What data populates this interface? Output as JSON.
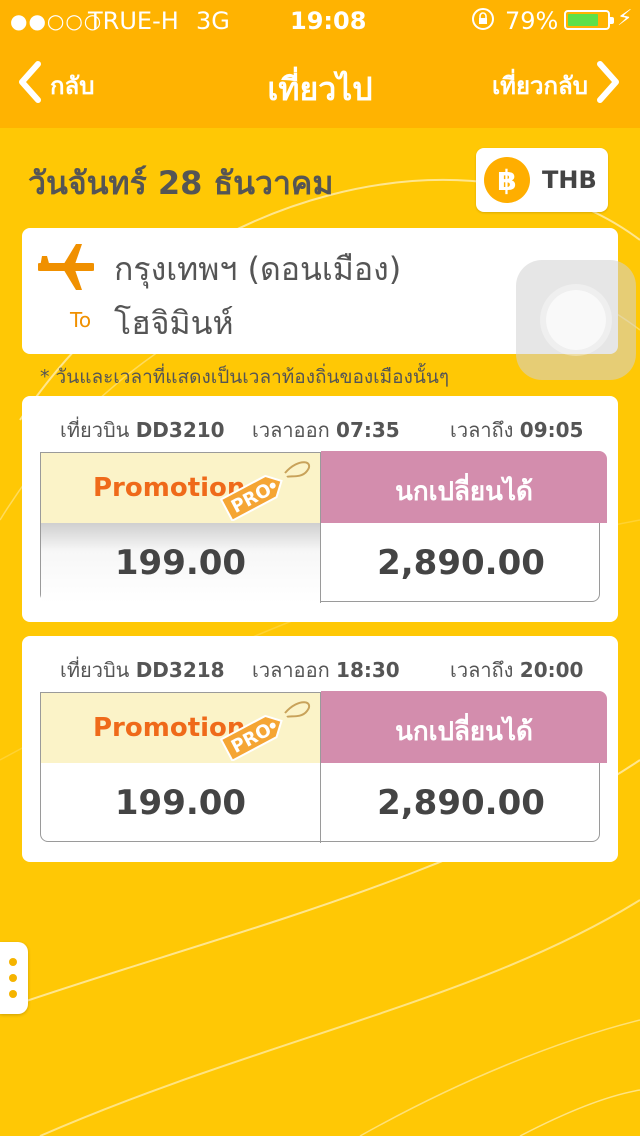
{
  "status_bar": {
    "signal": "●●○○○",
    "carrier": "TRUE-H",
    "network": "3G",
    "time": "19:08",
    "battery_percent": "79%",
    "battery_level": 0.79
  },
  "nav": {
    "back_label": "กลับ",
    "title": "เที่ยวไป",
    "forward_label": "เที่ยวกลับ"
  },
  "date": "วันจันทร์ 28 ธันวาคม",
  "currency": {
    "symbol": "฿",
    "code": "THB"
  },
  "route": {
    "from": "กรุงเทพฯ (ดอนเมือง)",
    "to_label": "To",
    "to": "โฮจิมินห์"
  },
  "note": "* วันและเวลาที่แสดงเป็นเวลาท้องถิ่นของเมืองนั้นๆ",
  "flights": [
    {
      "flight_label": "เที่ยวบิน",
      "flight_no": "DD3210",
      "depart_label": "เวลาออก",
      "depart_time": "07:35",
      "arrive_label": "เวลาถึง",
      "arrive_time": "09:05",
      "promo_label": "Promotion",
      "promo_tag": "PRO",
      "promo_price": "199.00",
      "flex_label": "นกเปลี่ยนได้",
      "flex_price": "2,890.00"
    },
    {
      "flight_label": "เที่ยวบิน",
      "flight_no": "DD3218",
      "depart_label": "เวลาออก",
      "depart_time": "18:30",
      "arrive_label": "เวลาถึง",
      "arrive_time": "20:00",
      "promo_label": "Promotion",
      "promo_tag": "PRO",
      "promo_price": "199.00",
      "flex_label": "นกเปลี่ยนได้",
      "flex_price": "2,890.00"
    }
  ],
  "colors": {
    "background": "#ffc805",
    "navbar": "#ffb301",
    "promo_head": "#fbf3c8",
    "promo_text": "#ef6a1a",
    "flex_head": "#d38dad",
    "accent_orange": "#f09000"
  }
}
